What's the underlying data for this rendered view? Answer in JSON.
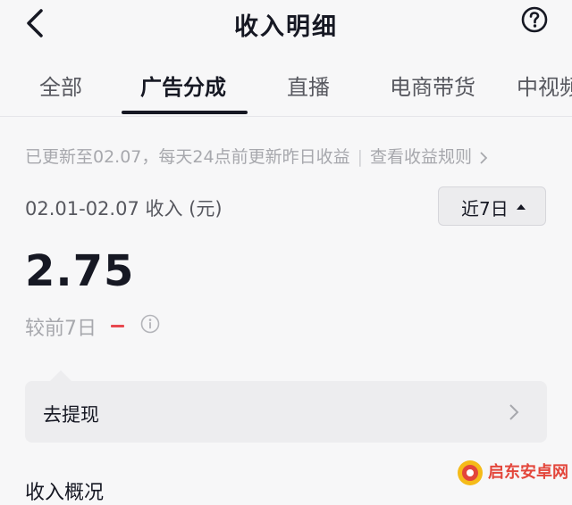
{
  "header": {
    "title": "收入明细",
    "back_icon": "chevron-left-icon",
    "help_icon": "question-circle-icon"
  },
  "tabs": [
    {
      "label": "全部",
      "active": false
    },
    {
      "label": "广告分成",
      "active": true
    },
    {
      "label": "直播",
      "active": false
    },
    {
      "label": "电商带货",
      "active": false
    },
    {
      "label": "中视频",
      "active": false
    }
  ],
  "notice": {
    "text": "已更新至02.07，每天24点前更新昨日收益",
    "link": "查看收益规则"
  },
  "period": {
    "label": "02.01-02.07 收入 (元)",
    "range_button": "近7日"
  },
  "amount": "2.75",
  "compare": {
    "label": "较前7日",
    "change": "–"
  },
  "withdraw": {
    "label": "去提现"
  },
  "section": {
    "title": "收入概况"
  },
  "watermark": {
    "text": "启东安卓网"
  },
  "colors": {
    "accent": "#161823",
    "negative": "#e8484f",
    "muted": "#a7a8ad",
    "watermark": "#e3463b"
  }
}
